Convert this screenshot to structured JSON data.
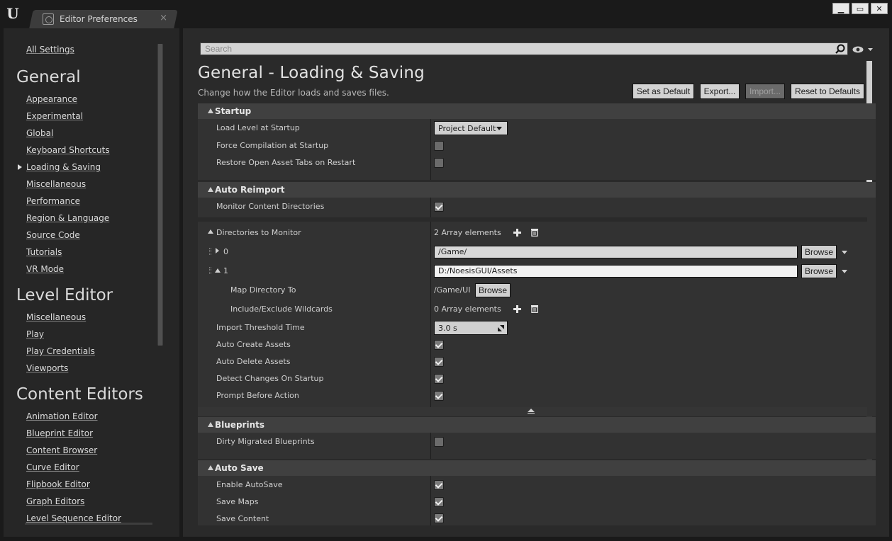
{
  "window": {
    "tab_title": "Editor Preferences",
    "tab_close": "×",
    "minimize": "▁",
    "maximize": "▭",
    "close": "✕"
  },
  "sidebar": {
    "all_settings": "All Settings",
    "sections": [
      {
        "title": "General",
        "items": [
          "Appearance",
          "Experimental",
          "Global",
          "Keyboard Shortcuts",
          "Loading & Saving",
          "Miscellaneous",
          "Performance",
          "Region & Language",
          "Source Code",
          "Tutorials",
          "VR Mode"
        ],
        "selected": "Loading & Saving"
      },
      {
        "title": "Level Editor",
        "items": [
          "Miscellaneous",
          "Play",
          "Play Credentials",
          "Viewports"
        ]
      },
      {
        "title": "Content Editors",
        "items": [
          "Animation Editor",
          "Blueprint Editor",
          "Content Browser",
          "Curve Editor",
          "Flipbook Editor",
          "Graph Editors",
          "Level Sequence Editor"
        ]
      }
    ]
  },
  "search": {
    "placeholder": "Search"
  },
  "header": {
    "title": "General - Loading & Saving",
    "subtitle": "Change how the Editor loads and saves files.",
    "buttons": {
      "set_default": "Set as Default",
      "export": "Export...",
      "import": "Import...",
      "reset": "Reset to Defaults"
    }
  },
  "startup": {
    "title": "Startup",
    "load_level_label": "Load Level at Startup",
    "load_level_value": "Project Default",
    "force_compilation_label": "Force Compilation at Startup",
    "force_compilation": false,
    "restore_tabs_label": "Restore Open Asset Tabs on Restart",
    "restore_tabs": false
  },
  "auto_reimport": {
    "title": "Auto Reimport",
    "monitor_label": "Monitor Content Directories",
    "monitor": true,
    "dirs_label": "Directories to Monitor",
    "dirs_count": "2 Array elements",
    "dir0_index": "0",
    "dir0_value": "/Game/",
    "dir1_index": "1",
    "dir1_value": "D:/NoesisGUI/Assets",
    "browse": "Browse",
    "map_dir_label": "Map Directory To",
    "map_dir_value": "/Game/UI",
    "wildcards_label": "Include/Exclude Wildcards",
    "wildcards_count": "0 Array elements",
    "threshold_label": "Import Threshold Time",
    "threshold_value": "3.0 s",
    "auto_create_label": "Auto Create Assets",
    "auto_create": true,
    "auto_delete_label": "Auto Delete Assets",
    "auto_delete": true,
    "detect_changes_label": "Detect Changes On Startup",
    "detect_changes": true,
    "prompt_label": "Prompt Before Action",
    "prompt": true
  },
  "blueprints": {
    "title": "Blueprints",
    "dirty_label": "Dirty Migrated Blueprints",
    "dirty": false
  },
  "auto_save": {
    "title": "Auto Save",
    "enable_label": "Enable AutoSave",
    "enable": true,
    "save_maps_label": "Save Maps",
    "save_maps": true,
    "save_content_label": "Save Content",
    "save_content": true
  }
}
